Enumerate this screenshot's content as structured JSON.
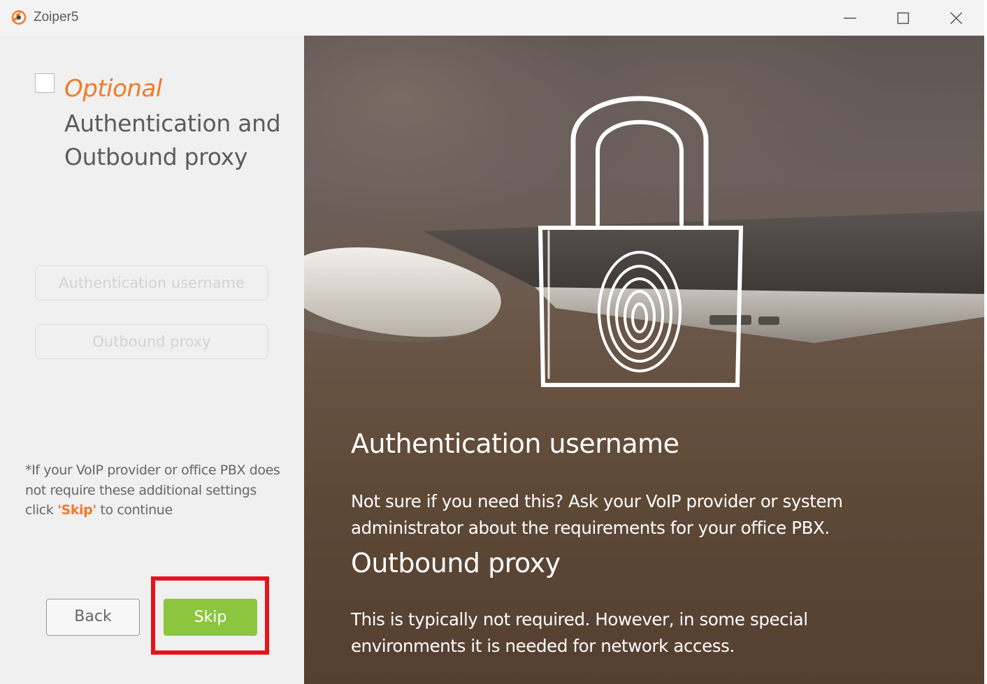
{
  "window": {
    "title": "Zoiper5",
    "logo_icon": "zoiper-logo-icon"
  },
  "left": {
    "optional_label": "Optional",
    "heading_line1": "Authentication and",
    "heading_line2": "Outbound proxy",
    "auth_username_placeholder": "Authentication username",
    "outbound_proxy_placeholder": "Outbound proxy",
    "note": {
      "line1": "*If your VoIP provider or office PBX does",
      "line2": "not require these additional settings",
      "line3_prefix": "click ",
      "line3_skip": "'Skip'",
      "line3_suffix": " to continue"
    },
    "back_label": "Back",
    "skip_label": "Skip"
  },
  "right": {
    "section1_title": "Authentication username",
    "section1_text_line1": " Not sure if you need this? Ask your VoIP provider or system",
    "section1_text_line2": "administrator about the requirements for your office PBX.",
    "section2_title": "Outbound proxy",
    "section2_text_line1": " This is typically not required. However, in some special",
    "section2_text_line2": "environments it is needed for network access."
  },
  "colors": {
    "accent_orange": "#f07a2a",
    "skip_green": "#8cc63e",
    "highlight_red": "#e8121c"
  }
}
